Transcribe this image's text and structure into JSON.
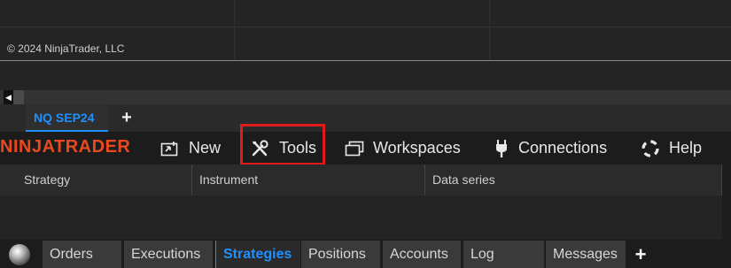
{
  "chart": {
    "copyright": "© 2024 NinjaTrader, LLC"
  },
  "chart_tabs": [
    {
      "label": "NQ SEP24",
      "active": true
    }
  ],
  "menubar": {
    "brand": "NINJATRADER",
    "brand_color": "#e8491f",
    "items": [
      {
        "label": "New",
        "icon": "new-window-icon"
      },
      {
        "label": "Tools",
        "icon": "tools-icon",
        "highlighted": true
      },
      {
        "label": "Workspaces",
        "icon": "workspaces-icon"
      },
      {
        "label": "Connections",
        "icon": "plug-icon"
      },
      {
        "label": "Help",
        "icon": "help-lifebuoy-icon"
      }
    ]
  },
  "strategies_grid": {
    "columns": [
      "Strategy",
      "Instrument",
      "Data series"
    ],
    "rows": []
  },
  "bottom_tabs": {
    "items": [
      {
        "label": "Orders",
        "active": false
      },
      {
        "label": "Executions",
        "active": false
      },
      {
        "label": "Strategies",
        "active": true
      },
      {
        "label": "Positions",
        "active": false
      },
      {
        "label": "Accounts",
        "active": false
      },
      {
        "label": "Log",
        "active": false
      },
      {
        "label": "Messages",
        "active": false
      }
    ]
  },
  "colors": {
    "accent_blue": "#1e90ff",
    "highlight_red": "#e01b1b",
    "background": "#242424"
  }
}
